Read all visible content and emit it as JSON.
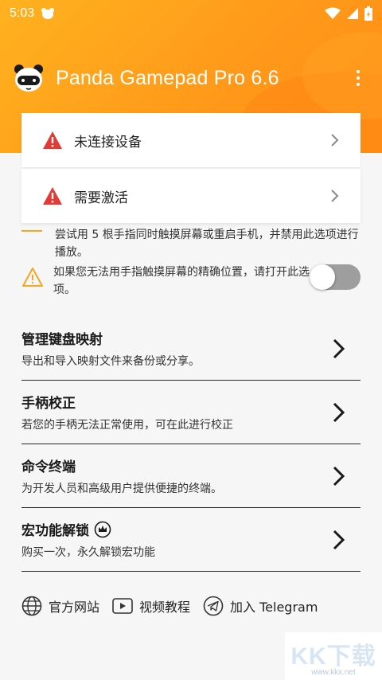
{
  "status": {
    "time": "5:03"
  },
  "app": {
    "title": "Panda Gamepad Pro 6.6"
  },
  "alerts": [
    {
      "label": "未连接设备"
    },
    {
      "label": "需要激活"
    }
  ],
  "tips": {
    "partial": "尝试用 5 根手指同时触摸屏幕或重启手机，并禁用此选项进行播放。",
    "touch_position": "如果您无法用手指触摸屏幕的精确位置，请打开此选项。",
    "touch_toggle_on": false
  },
  "menu": [
    {
      "title": "管理键盘映射",
      "subtitle": "导出和导入映射文件来备份或分享。"
    },
    {
      "title": "手柄校正",
      "subtitle": "若您的手柄无法正常使用，可在此进行校正"
    },
    {
      "title": "命令终端",
      "subtitle": "为开发人员和高级用户提供便捷的终端。"
    },
    {
      "title": "宏功能解锁",
      "subtitle": "购买一次，永久解锁宏功能"
    }
  ],
  "links": [
    {
      "label": "官方网站",
      "icon": "globe-icon"
    },
    {
      "label": "视频教程",
      "icon": "video-icon"
    },
    {
      "label": "加入 Telegram",
      "icon": "telegram-icon"
    }
  ],
  "watermark": {
    "main": "KK下载",
    "sub": "www.kkx.net"
  },
  "colors": {
    "header": "#ff9f1c",
    "warning": "#e53935",
    "accent": "#f5a623"
  }
}
